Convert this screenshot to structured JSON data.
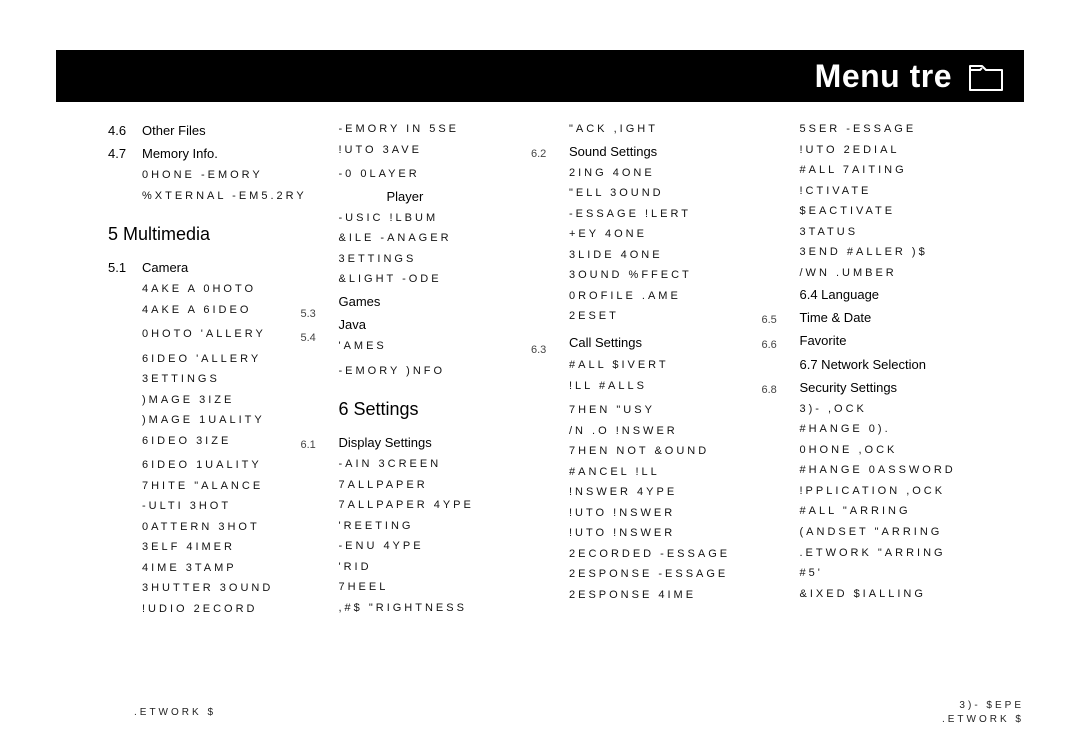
{
  "header": {
    "title": "Menu tre"
  },
  "col1": {
    "r0": {
      "n": "4.6",
      "t": "Other Files"
    },
    "r1": {
      "n": "4.7",
      "t": "Memory Info."
    },
    "r2": "0HONE -EMORY",
    "r3": "%XTERNAL -EM5.2RY",
    "sec1": "5 Multimedia",
    "r4": {
      "n": "5.1",
      "t": "Camera"
    },
    "r5": "4AKE A 0HOTO",
    "r6a": "4AKE A 6IDEO",
    "r6b": "5.3",
    "r7a": "0HOTO 'ALLERY",
    "r7b": "5.4",
    "r8": "6IDEO 'ALLERY",
    "r9": "3ETTINGS",
    "r10": ")MAGE 3IZE",
    "r11": ")MAGE 1UALITY",
    "r12a": "6IDEO 3IZE",
    "r12b": "6.1",
    "r13": "6IDEO 1UALITY",
    "r14": "7HITE \"ALANCE",
    "r15": "-ULTI 3HOT",
    "r16": "0ATTERN 3HOT",
    "r17": "3ELF 4IMER",
    "r18": "4IME 3TAMP",
    "r19": "3HUTTER 3OUND",
    "r20": "!UDIO 2ECORD"
  },
  "col2": {
    "r0": "-EMORY IN 5SE",
    "r1a": "!UTO 3AVE",
    "r1b": "6.2",
    "r2": "-0 0LAYER",
    "r3": {
      "n": "",
      "t": "Player"
    },
    "r4": "-USIC !LBUM",
    "r5": "&ILE -ANAGER",
    "r6": "3ETTINGS",
    "r7": "&LIGHT -ODE",
    "r8": {
      "t": "Games"
    },
    "r9": {
      "t": "Java"
    },
    "r10a": "'AMES",
    "r10b": "6.3",
    "r11": "-EMORY )NFO",
    "sec1": "6 Settings",
    "r12": {
      "t": "Display Settings"
    },
    "r13": "-AIN 3CREEN",
    "r14": "7ALLPAPER",
    "r15": "7ALLPAPER 4YPE",
    "r16": "'REETING",
    "r17": "-ENU 4YPE",
    "r18": "'RID",
    "r19": "7HEEL",
    "r20": ",#$ \"RIGHTNESS"
  },
  "col3": {
    "r0": "\"ACK ,IGHT",
    "r1": {
      "t": "Sound Settings"
    },
    "r2": "2ING 4ONE",
    "r3": "\"ELL 3OUND",
    "r4": "-ESSAGE !LERT",
    "r5": "+EY 4ONE",
    "r6": "3LIDE 4ONE",
    "r7": "3OUND %FFECT",
    "r8": "0ROFILE .AME",
    "r9a": "2ESET",
    "r9b": "6.5",
    "r10": {
      "t": "Call Settings",
      "n": "6.6"
    },
    "r11": "#ALL $IVERT",
    "r12a": "!LL #ALLS",
    "r12b": "6.8",
    "r13": "7HEN \"USY",
    "r14": "/N .O !NSWER",
    "r15": "7HEN NOT &OUND",
    "r16": "#ANCEL !LL",
    "r17": "!NSWER 4YPE",
    "r18": "!UTO !NSWER",
    "r19": "!UTO !NSWER",
    "r20": "2ECORDED -ESSAGE",
    "r21": "2ESPONSE -ESSAGE",
    "r22": "2ESPONSE 4IME"
  },
  "col4": {
    "r0": "5SER -ESSAGE",
    "r1": "!UTO 2EDIAL",
    "r2": "#ALL 7AITING",
    "r3": "!CTIVATE",
    "r4": "$EACTIVATE",
    "r5": "3TATUS",
    "r6": "3END #ALLER )$",
    "r7": "/WN .UMBER",
    "r8": {
      "t": "6.4   Language"
    },
    "r9": {
      "t": "Time & Date"
    },
    "r10": {
      "t": "Favorite"
    },
    "r11": {
      "t": "6.7   Network Selection"
    },
    "r12": {
      "t": "Security Settings"
    },
    "r13": "3)- ,OCK",
    "r14": "#HANGE 0).",
    "r15": "0HONE ,OCK",
    "r16": "#HANGE 0ASSWORD",
    "r17": "!PPLICATION ,OCK",
    "r18": "#ALL \"ARRING",
    "r19": "(ANDSET \"ARRING",
    "r20": ".ETWORK \"ARRING",
    "r21": "#5'",
    "r22": "&IXED $IALLING"
  },
  "footer": {
    "left": ".ETWORK $",
    "right1": "3)- $EPE",
    "right2": ".ETWORK $"
  }
}
